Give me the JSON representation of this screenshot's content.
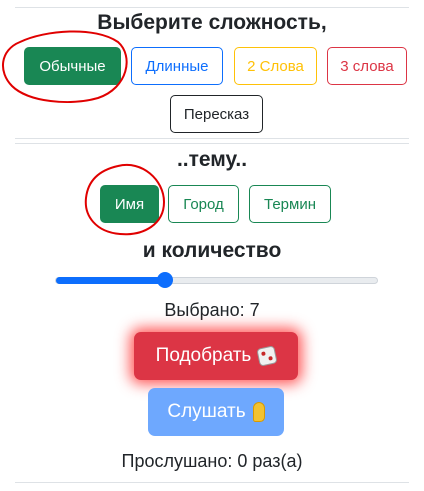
{
  "difficulty": {
    "title": "Выберите сложность,",
    "options": [
      "Обычные",
      "Длинные",
      "2 Слова",
      "3 слова",
      "Пересказ"
    ]
  },
  "topic": {
    "title": "..тему..",
    "options": [
      "Имя",
      "Город",
      "Термин"
    ]
  },
  "count": {
    "title": "и количество",
    "slider_fraction": 0.34,
    "selected_text": "Выбрано: 7"
  },
  "actions": {
    "pick_label": "Подобрать",
    "listen_label": "Слушать"
  },
  "status": {
    "listened_text": "Прослушано: 0 раз(а)"
  },
  "colors": {
    "success": "#198754",
    "primary": "#0d6efd",
    "warning": "#ffc107",
    "danger": "#dc3545",
    "annotation": "#e00000"
  },
  "icons": {
    "pick": "dice-icon",
    "listen": "ear-icon"
  }
}
